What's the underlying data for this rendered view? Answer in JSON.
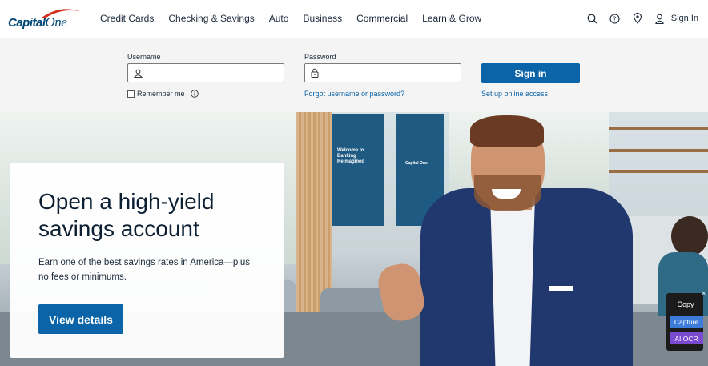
{
  "header": {
    "logo_text_main": "Capital",
    "logo_text_one": "One",
    "nav": [
      "Credit Cards",
      "Checking & Savings",
      "Auto",
      "Business",
      "Commercial",
      "Learn & Grow"
    ],
    "sign_in": "Sign In",
    "icons": [
      "search-icon",
      "help-icon",
      "location-icon",
      "user-icon"
    ]
  },
  "login": {
    "username_label": "Username",
    "password_label": "Password",
    "username_value": "",
    "password_value": "",
    "sign_in_button": "Sign in",
    "remember_me": "Remember me",
    "forgot_link": "Forgot username or password?",
    "setup_link": "Set up online access"
  },
  "hero": {
    "title": "Open a high-yield savings account",
    "body": "Earn one of the best savings rates in America—plus no fees or minimums.",
    "cta": "View details",
    "panel_text": "Welcome to Banking Reimagined",
    "panel_logo": "Capital One"
  },
  "tool_overlay": {
    "copy": "Copy",
    "capture": "Capture",
    "ai_ocr": "AI OCR",
    "close": "×"
  },
  "colors": {
    "brand_blue": "#004878",
    "button_blue": "#0c64a8",
    "swoosh_red": "#d22e1e"
  }
}
